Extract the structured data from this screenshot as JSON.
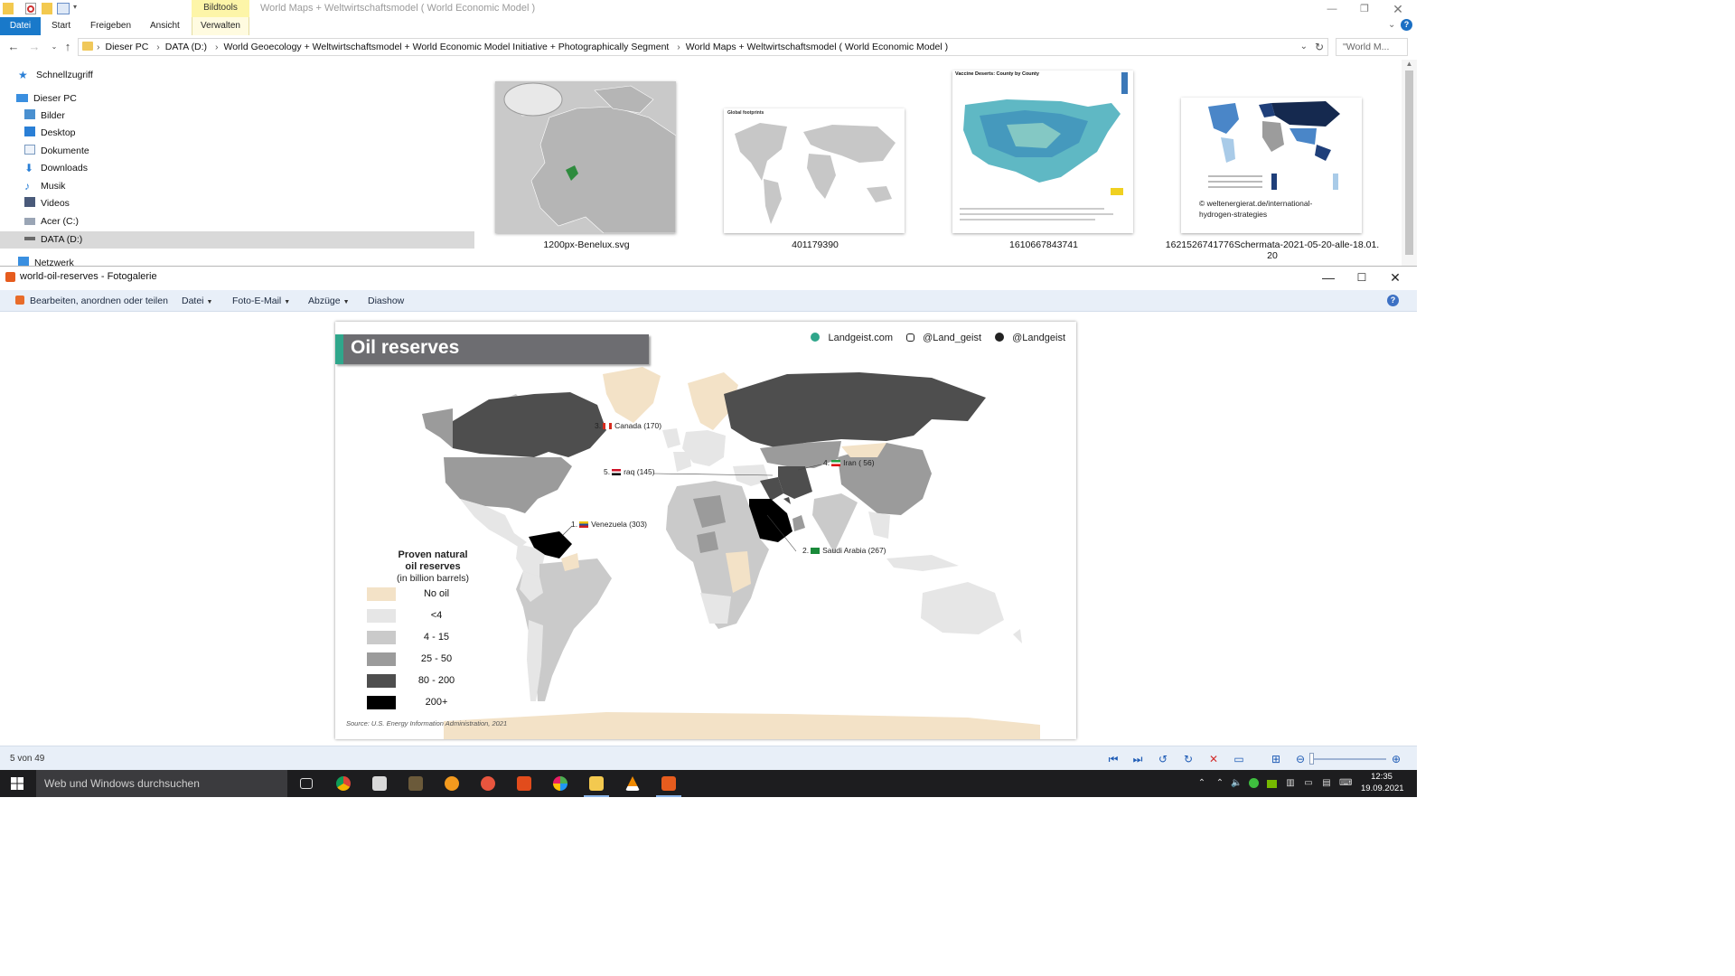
{
  "explorer": {
    "title": "World Maps + Weltwirtschaftsmodel ( World Economic Model )",
    "context_tab": "Bildtools",
    "tabs": [
      "Datei",
      "Start",
      "Freigeben",
      "Ansicht",
      "Verwalten"
    ],
    "breadcrumb": [
      "Dieser PC",
      "DATA (D:)",
      "World Geoecology + Weltwirtschaftsmodel + World Economic Model  Initiative + Photographically Segment",
      "World Maps + Weltwirtschaftsmodel ( World Economic Model )"
    ],
    "search_placeholder": "\"World M...",
    "nav": {
      "quick_access": "Schnellzugriff",
      "this_pc": "Dieser PC",
      "items": [
        "Bilder",
        "Desktop",
        "Dokumente",
        "Downloads",
        "Musik",
        "Videos",
        "Acer (C:)",
        "DATA (D:)"
      ],
      "network": "Netzwerk"
    },
    "files": [
      {
        "name": "1200px-Benelux.svg"
      },
      {
        "name": "401179390",
        "inner_title": "Global footprints"
      },
      {
        "name": "1610667843741",
        "inner_title": "Vaccine Deserts: County by County"
      },
      {
        "name": "1621526741776Schermata-2021-05-20-alle-18.01.20",
        "caption_lines": [
          "1621526741776Schermata-2021-05-20-alle-18.01.",
          "20"
        ],
        "inner_text": [
          "© weltenergierat.de/international-",
          "hydrogen-strategies"
        ]
      }
    ]
  },
  "gallery": {
    "title": "world-oil-reserves - Fotogalerie",
    "menu": {
      "edit": "Bearbeiten, anordnen oder teilen",
      "file": "Datei",
      "email": "Foto-E-Mail",
      "prints": "Abzüge",
      "slideshow": "Diashow"
    },
    "status": "5 von 49"
  },
  "map": {
    "title": "Oil reserves",
    "site": "Landgeist.com",
    "instagram": "@Land_geist",
    "twitter": "@Landgeist",
    "legend_title_1": "Proven natural",
    "legend_title_2": "oil reserves",
    "legend_sub": "(in billion barrels)",
    "legend": [
      {
        "label": "No oil",
        "color": "#f3e2c7"
      },
      {
        "label": "<4",
        "color": "#e6e6e6"
      },
      {
        "label": "4 - 15",
        "color": "#cacaca"
      },
      {
        "label": "25 - 50",
        "color": "#9b9b9b"
      },
      {
        "label": "80 - 200",
        "color": "#4e4e4e"
      },
      {
        "label": "200+",
        "color": "#000000"
      }
    ],
    "callouts": {
      "venezuela": {
        "rank": "1.",
        "name": "Venezuela (303)"
      },
      "saudi": {
        "rank": "2.",
        "name": "Saudi Arabia (267)"
      },
      "canada": {
        "rank": "3.",
        "name": "Canada (170)"
      },
      "iran": {
        "rank": "4.",
        "name": "Iran ( 56)"
      },
      "iraq": {
        "rank": "5.",
        "name": "raq (145)"
      }
    },
    "source": "Source: U.S. Energy Information Administration, 2021"
  },
  "taskbar": {
    "search": "Web und Windows durchsuchen",
    "time": "12:35",
    "date": "19.09.2021"
  }
}
